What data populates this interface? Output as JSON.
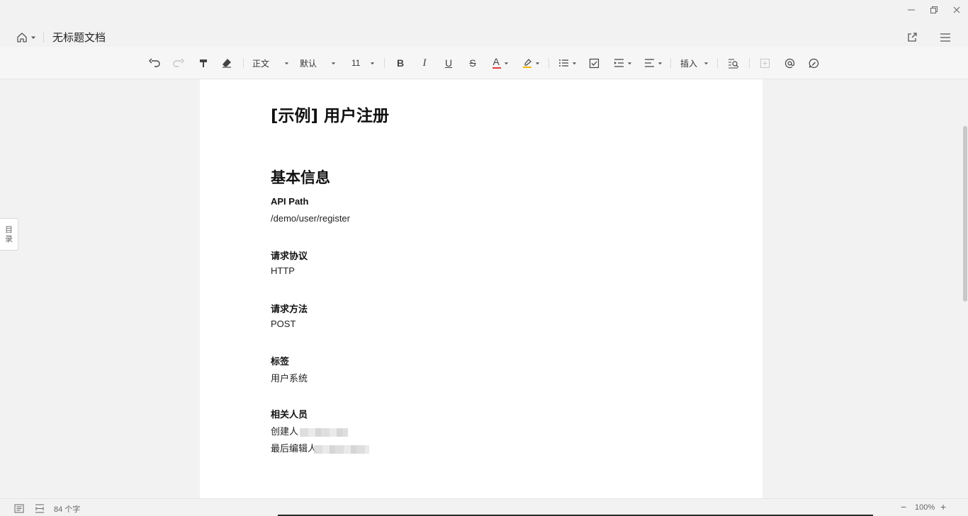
{
  "window": {
    "title": "无标题文档",
    "controls": [
      "minimize-icon",
      "restore-icon",
      "close-icon"
    ]
  },
  "header": {
    "home_icon": "home-icon",
    "share_icon": "share-icon",
    "menu_icon": "hamburger-menu-icon"
  },
  "toolbar": {
    "undo_icon": "undo-icon",
    "redo_icon": "redo-icon",
    "format_painter_icon": "format-painter-icon",
    "clear_format_icon": "eraser-icon",
    "paragraph_style": "正文",
    "font_family": "默认",
    "font_size": "11",
    "bold": "B",
    "italic": "I",
    "underline": "U",
    "strikethrough": "S",
    "font_color": "A",
    "font_color_hex": "#e53935",
    "highlight_icon": "highlighter-icon",
    "highlight_color_hex": "#f5b800",
    "list_icon": "bulleted-list-icon",
    "checkbox_icon": "checklist-icon",
    "indent_icon": "indent-icon",
    "align_icon": "align-left-icon",
    "insert": "插入",
    "find_icon": "find-replace-icon",
    "add_icon": "add-block-icon",
    "mention_icon": "at-mention-icon",
    "comment_icon": "comment-icon"
  },
  "toc": {
    "label_1": "目",
    "label_2": "录"
  },
  "document": {
    "title": "[示例] 用户注册",
    "section_heading": "基本信息",
    "fields": [
      {
        "label": "API Path",
        "value": "/demo/user/register"
      },
      {
        "label": "请求协议",
        "value": "HTTP"
      },
      {
        "label": "请求方法",
        "value": "POST"
      },
      {
        "label": "标签",
        "value": "用户系统"
      },
      {
        "label": "相关人员",
        "value_1": "创建人",
        "value_2": "最后编辑人"
      }
    ]
  },
  "status": {
    "outline_icon": "outline-view-icon",
    "page_icon": "page-width-icon",
    "word_count": "84 个字",
    "zoom": "100%",
    "zoom_out": "−",
    "zoom_in": "+"
  }
}
